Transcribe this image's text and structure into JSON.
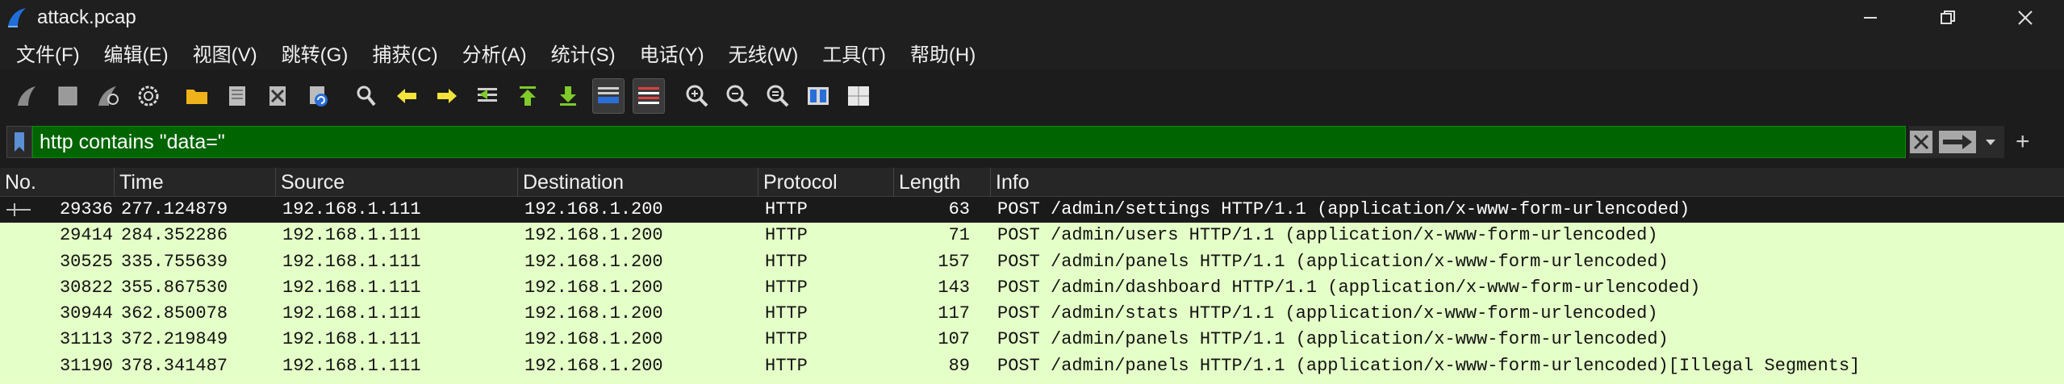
{
  "window": {
    "title": "attack.pcap"
  },
  "menu": [
    "文件(F)",
    "编辑(E)",
    "视图(V)",
    "跳转(G)",
    "捕获(C)",
    "分析(A)",
    "统计(S)",
    "电话(Y)",
    "无线(W)",
    "工具(T)",
    "帮助(H)"
  ],
  "filter": {
    "value": "http contains \"data=\""
  },
  "columns": {
    "no": "No.",
    "time": "Time",
    "source": "Source",
    "destination": "Destination",
    "protocol": "Protocol",
    "length": "Length",
    "info": "Info"
  },
  "rows": [
    {
      "no": "29336",
      "time": "277.124879",
      "src": "192.168.1.111",
      "dst": "192.168.1.200",
      "proto": "HTTP",
      "len": "63",
      "info": "POST /admin/settings HTTP/1.1  (application/x-www-form-urlencoded)"
    },
    {
      "no": "29414",
      "time": "284.352286",
      "src": "192.168.1.111",
      "dst": "192.168.1.200",
      "proto": "HTTP",
      "len": "71",
      "info": "POST /admin/users HTTP/1.1  (application/x-www-form-urlencoded)"
    },
    {
      "no": "30525",
      "time": "335.755639",
      "src": "192.168.1.111",
      "dst": "192.168.1.200",
      "proto": "HTTP",
      "len": "157",
      "info": "POST /admin/panels HTTP/1.1  (application/x-www-form-urlencoded)"
    },
    {
      "no": "30822",
      "time": "355.867530",
      "src": "192.168.1.111",
      "dst": "192.168.1.200",
      "proto": "HTTP",
      "len": "143",
      "info": "POST /admin/dashboard HTTP/1.1  (application/x-www-form-urlencoded)"
    },
    {
      "no": "30944",
      "time": "362.850078",
      "src": "192.168.1.111",
      "dst": "192.168.1.200",
      "proto": "HTTP",
      "len": "117",
      "info": "POST /admin/stats HTTP/1.1  (application/x-www-form-urlencoded)"
    },
    {
      "no": "31113",
      "time": "372.219849",
      "src": "192.168.1.111",
      "dst": "192.168.1.200",
      "proto": "HTTP",
      "len": "107",
      "info": "POST /admin/panels HTTP/1.1  (application/x-www-form-urlencoded)"
    },
    {
      "no": "31190",
      "time": "378.341487",
      "src": "192.168.1.111",
      "dst": "192.168.1.200",
      "proto": "HTTP",
      "len": "89",
      "info": "POST /admin/panels HTTP/1.1  (application/x-www-form-urlencoded)[Illegal Segments]"
    }
  ],
  "selected_row": 0,
  "colors": {
    "filter_valid": "#006400",
    "row_bg": "#e4ffc7",
    "selected_bg": "#1a1a1a"
  },
  "icons": {
    "toolbar": [
      "start-capture-icon",
      "stop-capture-icon",
      "restart-capture-icon",
      "capture-options-icon",
      "open-file-icon",
      "save-file-icon",
      "close-file-icon",
      "reload-file-icon",
      "find-packet-icon",
      "go-back-icon",
      "go-forward-icon",
      "go-to-packet-icon",
      "first-packet-icon",
      "last-packet-icon",
      "autoscroll-icon",
      "colorize-icon",
      "zoom-in-icon",
      "zoom-out-icon",
      "normal-size-icon",
      "resize-columns-icon",
      "layout-icon"
    ]
  }
}
